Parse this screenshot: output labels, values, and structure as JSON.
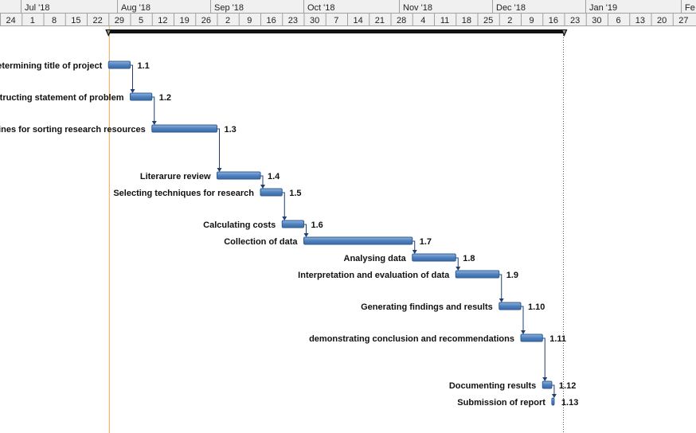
{
  "timescale": {
    "months": [
      "Jul '18",
      "Aug '18",
      "Sep '18",
      "Oct '18",
      "Nov '18",
      "Dec '18",
      "Jan '19",
      "Fe"
    ],
    "days": [
      "24",
      "1",
      "8",
      "15",
      "22",
      "29",
      "5",
      "12",
      "19",
      "26",
      "2",
      "9",
      "16",
      "23",
      "30",
      "7",
      "14",
      "21",
      "28",
      "4",
      "11",
      "18",
      "25",
      "2",
      "9",
      "16",
      "23",
      "30",
      "6",
      "13",
      "20",
      "27"
    ]
  },
  "today_marker": {
    "date": "2018-08-27"
  },
  "summary": {
    "start": "2018-08-27",
    "finish": "2019-01-21"
  },
  "tasks": [
    {
      "id": "1.1",
      "name": "Determining title of project",
      "start": "2018-08-27",
      "finish": "2018-09-02"
    },
    {
      "id": "1.2",
      "name": "Constructing statement of problem",
      "start": "2018-09-03",
      "finish": "2018-09-09"
    },
    {
      "id": "1.3",
      "name": "Establishing deadlines for sorting research resources",
      "start": "2018-09-10",
      "finish": "2018-09-30"
    },
    {
      "id": "1.4",
      "name": "Literarure review",
      "start": "2018-10-01",
      "finish": "2018-10-14"
    },
    {
      "id": "1.5",
      "name": "Selecting techniques for research",
      "start": "2018-10-15",
      "finish": "2018-10-21"
    },
    {
      "id": "1.6",
      "name": "Calculating costs",
      "start": "2018-10-22",
      "finish": "2018-10-28"
    },
    {
      "id": "1.7",
      "name": "Collection of data",
      "start": "2018-10-29",
      "finish": "2018-12-02"
    },
    {
      "id": "1.8",
      "name": "Analysing data",
      "start": "2018-12-03",
      "finish": "2018-12-16"
    },
    {
      "id": "1.9",
      "name": "Interpretation and evaluation of data",
      "start": "2018-12-17",
      "finish": "2018-12-30"
    },
    {
      "id": "1.10",
      "name": "Generating findings and results",
      "start": "2018-12-31",
      "finish": "2019-01-06"
    },
    {
      "id": "1.11",
      "name": "demonstrating conclusion and recommendations",
      "start": "2019-01-07",
      "finish": "2019-01-13"
    },
    {
      "id": "1.12",
      "name": "Documenting results",
      "start": "2019-01-14",
      "finish": "2019-01-16"
    },
    {
      "id": "1.13",
      "name": "Submission of report",
      "start": "2019-01-17",
      "finish": "2019-01-17",
      "milestone": true
    }
  ],
  "colors": {
    "bar_fill": "#4f81bd",
    "bar_border": "#2f5a8f",
    "link": "#1f3f73",
    "today_line": "#e3a555",
    "header_bg": "#f0f0f0",
    "header_border": "#a0a0a0"
  }
}
